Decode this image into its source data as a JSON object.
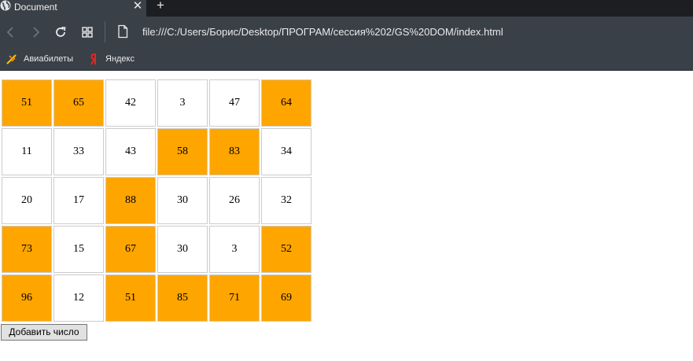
{
  "browser": {
    "tab": {
      "title": "Document",
      "icon": "globe-icon",
      "close_label": "✕"
    },
    "new_tab_label": "+",
    "url": "file:///C:/Users/Борис/Desktop/ПРОГРАМ/сессия%202/GS%20DOM/index.html",
    "bookmarks": [
      {
        "label": "Авиабилеты",
        "icon": "plane-icon"
      },
      {
        "label": "Яндекс",
        "icon": "yandex-icon"
      }
    ],
    "colors": {
      "chrome": "#3a4047",
      "tabstrip": "#1c1e22",
      "text": "#e9ebee"
    }
  },
  "table": {
    "highlight_color": "#ffa500",
    "rows": [
      [
        {
          "value": "51",
          "highlight": true
        },
        {
          "value": "65",
          "highlight": true
        },
        {
          "value": "42",
          "highlight": false
        },
        {
          "value": "3",
          "highlight": false
        },
        {
          "value": "47",
          "highlight": false
        },
        {
          "value": "64",
          "highlight": true
        }
      ],
      [
        {
          "value": "11",
          "highlight": false
        },
        {
          "value": "33",
          "highlight": false
        },
        {
          "value": "43",
          "highlight": false
        },
        {
          "value": "58",
          "highlight": true
        },
        {
          "value": "83",
          "highlight": true
        },
        {
          "value": "34",
          "highlight": false
        }
      ],
      [
        {
          "value": "20",
          "highlight": false
        },
        {
          "value": "17",
          "highlight": false
        },
        {
          "value": "88",
          "highlight": true
        },
        {
          "value": "30",
          "highlight": false
        },
        {
          "value": "26",
          "highlight": false
        },
        {
          "value": "32",
          "highlight": false
        }
      ],
      [
        {
          "value": "73",
          "highlight": true
        },
        {
          "value": "15",
          "highlight": false
        },
        {
          "value": "67",
          "highlight": true
        },
        {
          "value": "30",
          "highlight": false
        },
        {
          "value": "3",
          "highlight": false
        },
        {
          "value": "52",
          "highlight": true
        }
      ],
      [
        {
          "value": "96",
          "highlight": true
        },
        {
          "value": "12",
          "highlight": false
        },
        {
          "value": "51",
          "highlight": true
        },
        {
          "value": "85",
          "highlight": true
        },
        {
          "value": "71",
          "highlight": true
        },
        {
          "value": "69",
          "highlight": true
        }
      ]
    ]
  },
  "add_button_label": "Добавить число"
}
